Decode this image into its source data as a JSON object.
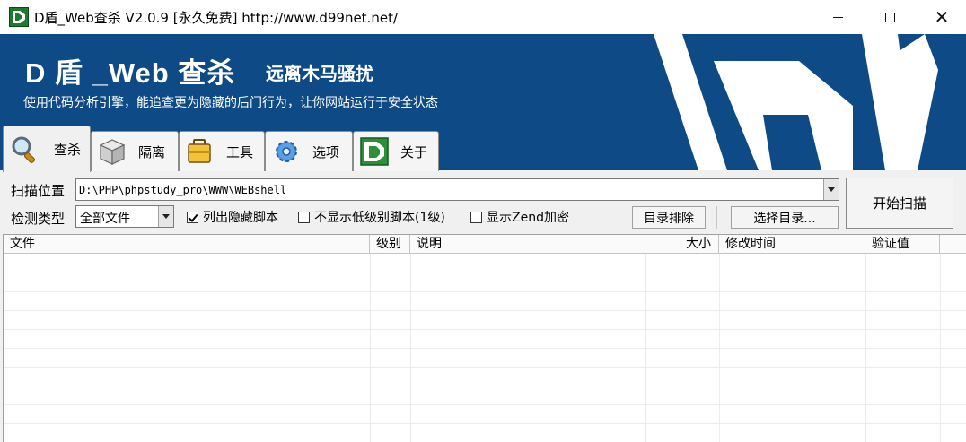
{
  "window": {
    "title": "D盾_Web查杀 V2.0.9 [永久免费] http://www.d99net.net/"
  },
  "banner": {
    "title": "D 盾 _Web 查杀",
    "subtitle": "远离木马骚扰",
    "description": "使用代码分析引擎，能追查更为隐藏的后门行为，让你网站运行于安全状态",
    "colors": {
      "background": "#0d4a86",
      "text": "#ffffff"
    }
  },
  "tabs": [
    {
      "label": "查杀",
      "icon": "magnifier-icon",
      "active": true
    },
    {
      "label": "隔离",
      "icon": "box-icon",
      "active": false
    },
    {
      "label": "工具",
      "icon": "toolbox-icon",
      "active": false
    },
    {
      "label": "选项",
      "icon": "gear-icon",
      "active": false
    },
    {
      "label": "关于",
      "icon": "d-logo-icon",
      "active": false
    }
  ],
  "scan": {
    "location_label": "扫描位置",
    "path_value": "D:\\PHP\\phpstudy_pro\\WWW\\WEBshell",
    "type_label": "检测类型",
    "type_value": "全部文件",
    "list_hidden_label": "列出隐藏脚本",
    "list_hidden_checked": true,
    "hide_low_label": "不显示低级别脚本(1级)",
    "hide_low_checked": false,
    "show_zend_label": "显示Zend加密",
    "show_zend_checked": false,
    "exclude_button": "目录排除",
    "choose_dir_button": "选择目录...",
    "start_button": "开始扫描"
  },
  "table": {
    "columns": [
      "文件",
      "级别",
      "说明",
      "大小",
      "修改时间",
      "验证值"
    ],
    "rows": []
  }
}
